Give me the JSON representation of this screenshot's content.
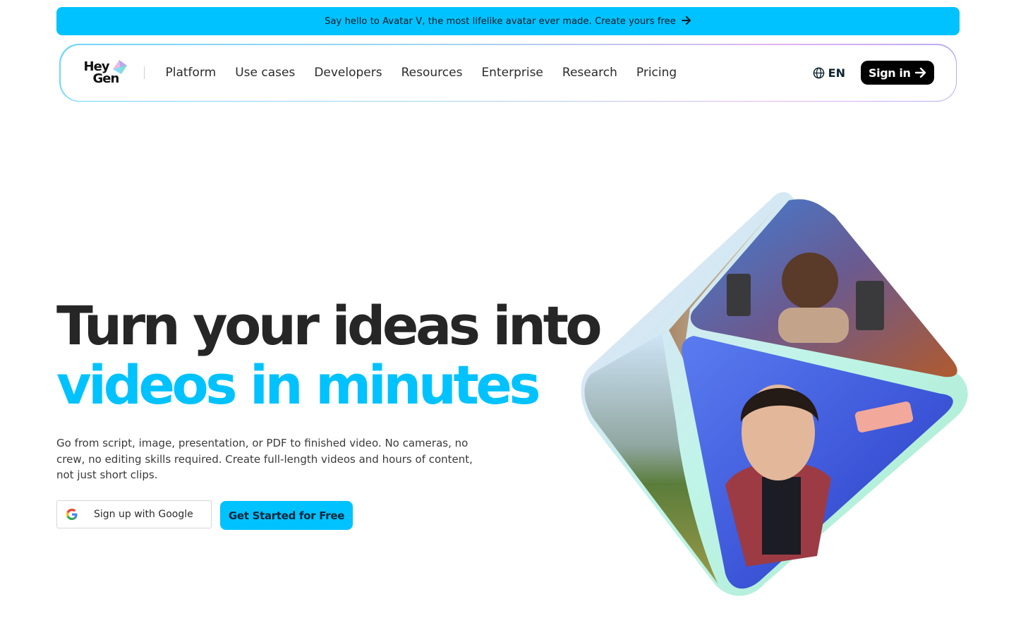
{
  "banner": {
    "text": "Say hello to Avatar V, the most lifelike avatar ever made. Create yours free",
    "arrow_icon": "arrow-right-icon"
  },
  "nav": {
    "logo": {
      "line1": "Hey",
      "line2": "Gen"
    },
    "menu": [
      {
        "label": "Platform"
      },
      {
        "label": "Use cases"
      },
      {
        "label": "Developers"
      },
      {
        "label": "Resources"
      },
      {
        "label": "Enterprise"
      },
      {
        "label": "Research"
      },
      {
        "label": "Pricing"
      }
    ],
    "language": {
      "label": "EN",
      "icon": "globe-icon"
    },
    "signin": {
      "label": "Sign in",
      "icon": "arrow-right-icon"
    }
  },
  "hero": {
    "title_line1": "Turn your ideas into",
    "title_line2": "videos in minutes",
    "description": "Go from script, image, presentation, or PDF to finished video. No cameras, no crew, no editing skills required. Create full-length videos and hours of content, not just short clips.",
    "google_button": "Sign up with Google",
    "start_button": "Get Started for Free"
  },
  "colors": {
    "accent": "#00c2ff",
    "title_dark": "#262626",
    "signin_bg": "#000000"
  }
}
